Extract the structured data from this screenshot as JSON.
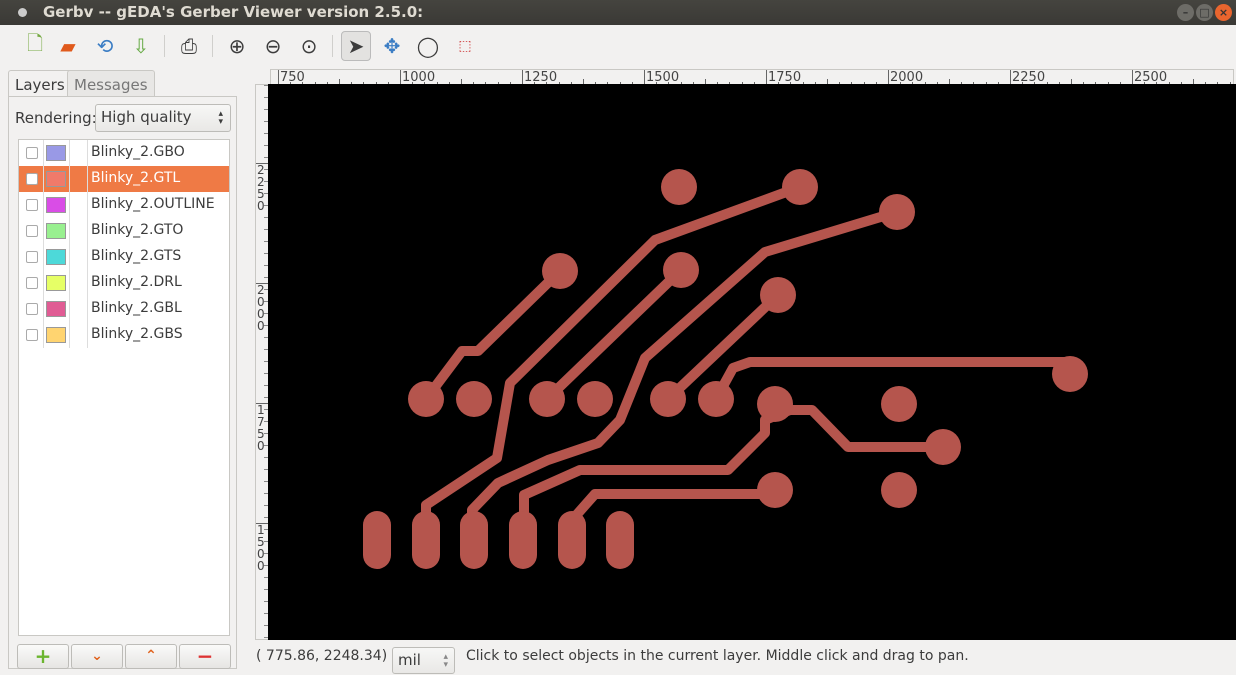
{
  "window": {
    "title": "Gerbv -- gEDA's Gerber Viewer version 2.5.0:",
    "controls": [
      "minimize",
      "maximize",
      "close"
    ]
  },
  "toolbar": {
    "icons": [
      "new-project-icon",
      "open-project-icon",
      "revert-icon",
      "save-icon",
      "print-icon",
      "zoom-in-icon",
      "zoom-out-icon",
      "zoom-fit-icon",
      "pointer-tool-icon",
      "pan-tool-icon",
      "zoom-tool-icon",
      "measure-tool-icon"
    ],
    "active_tool": "pointer"
  },
  "sidebar": {
    "tabs": [
      {
        "label": "Layers",
        "active": true
      },
      {
        "label": "Messages",
        "active": false
      }
    ],
    "rendering_label": "Rendering:",
    "rendering_value": "High quality",
    "layers": [
      {
        "name": "Blinky_2.GBO",
        "color": "#9999e6",
        "visible": false,
        "selected": false
      },
      {
        "name": "Blinky_2.GTL",
        "color": "#f07a6a",
        "visible": true,
        "selected": true
      },
      {
        "name": "Blinky_2.OUTLINE",
        "color": "#d94de6",
        "visible": false,
        "selected": false
      },
      {
        "name": "Blinky_2.GTO",
        "color": "#99f090",
        "visible": false,
        "selected": false
      },
      {
        "name": "Blinky_2.GTS",
        "color": "#4dd9d9",
        "visible": false,
        "selected": false
      },
      {
        "name": "Blinky_2.DRL",
        "color": "#e6ff66",
        "visible": false,
        "selected": false
      },
      {
        "name": "Blinky_2.GBL",
        "color": "#e05c94",
        "visible": false,
        "selected": false
      },
      {
        "name": "Blinky_2.GBS",
        "color": "#ffd470",
        "visible": false,
        "selected": false
      }
    ],
    "buttons": {
      "add": "+",
      "down": "⌄",
      "up": "⌃",
      "remove": "−"
    }
  },
  "rulers": {
    "horizontal": [
      "750",
      "1000",
      "1250",
      "1500",
      "1750",
      "2000",
      "2250",
      "2500"
    ],
    "vertical": [
      "2250",
      "2000",
      "1750",
      "1500"
    ]
  },
  "canvas": {
    "background": "#000000",
    "trace_color": "#b5554d"
  },
  "statusbar": {
    "coords": "( 775.86,  2248.34)",
    "unit": "mil",
    "message": "Click to select objects in the current layer. Middle click and drag to pan."
  }
}
